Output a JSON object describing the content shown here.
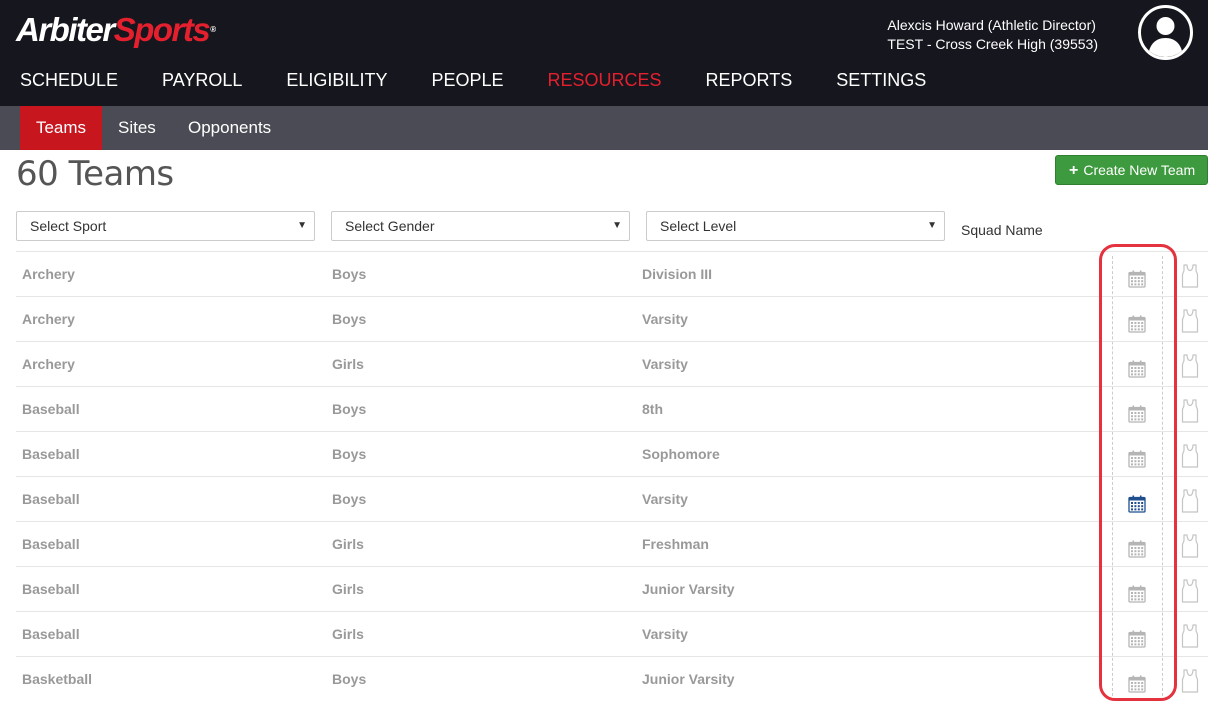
{
  "brand": {
    "logo_part1": "Arbiter",
    "logo_part2": "Sports",
    "logo_mark": "®",
    "accent_color": "#e4202e"
  },
  "user": {
    "name_role": "Alexcis Howard (Athletic Director)",
    "organization": "TEST - Cross Creek High (39553)",
    "avatar_icon": "user-avatar-icon"
  },
  "main_nav": [
    {
      "label": "SCHEDULE",
      "active": false
    },
    {
      "label": "PAYROLL",
      "active": false
    },
    {
      "label": "ELIGIBILITY",
      "active": false
    },
    {
      "label": "PEOPLE",
      "active": false
    },
    {
      "label": "RESOURCES",
      "active": true
    },
    {
      "label": "REPORTS",
      "active": false
    },
    {
      "label": "SETTINGS",
      "active": false
    }
  ],
  "sub_nav": [
    {
      "label": "Teams",
      "active": true
    },
    {
      "label": "Sites",
      "active": false
    },
    {
      "label": "Opponents",
      "active": false
    }
  ],
  "page": {
    "title": "60 Teams",
    "create_button_label": "Create New Team",
    "create_button_icon": "plus-icon",
    "create_button_color": "#3e9a3e"
  },
  "filters": {
    "sport": "Select Sport",
    "gender": "Select Gender",
    "level": "Select Level",
    "squad_name_label": "Squad Name"
  },
  "teams": [
    {
      "sport": "Archery",
      "gender": "Boys",
      "level": "Division III",
      "calendar_active": false
    },
    {
      "sport": "Archery",
      "gender": "Boys",
      "level": "Varsity",
      "calendar_active": false
    },
    {
      "sport": "Archery",
      "gender": "Girls",
      "level": "Varsity",
      "calendar_active": false
    },
    {
      "sport": "Baseball",
      "gender": "Boys",
      "level": "8th",
      "calendar_active": false
    },
    {
      "sport": "Baseball",
      "gender": "Boys",
      "level": "Sophomore",
      "calendar_active": false
    },
    {
      "sport": "Baseball",
      "gender": "Boys",
      "level": "Varsity",
      "calendar_active": true
    },
    {
      "sport": "Baseball",
      "gender": "Girls",
      "level": "Freshman",
      "calendar_active": false
    },
    {
      "sport": "Baseball",
      "gender": "Girls",
      "level": "Junior Varsity",
      "calendar_active": false
    },
    {
      "sport": "Baseball",
      "gender": "Girls",
      "level": "Varsity",
      "calendar_active": false
    },
    {
      "sport": "Basketball",
      "gender": "Boys",
      "level": "Junior Varsity",
      "calendar_active": false
    }
  ],
  "icons": {
    "calendar": "calendar-icon",
    "jersey": "jersey-icon"
  },
  "colors": {
    "calendar_inactive": "#b5b5b5",
    "calendar_active": "#1f4e8c",
    "highlight": "#e5323f"
  }
}
